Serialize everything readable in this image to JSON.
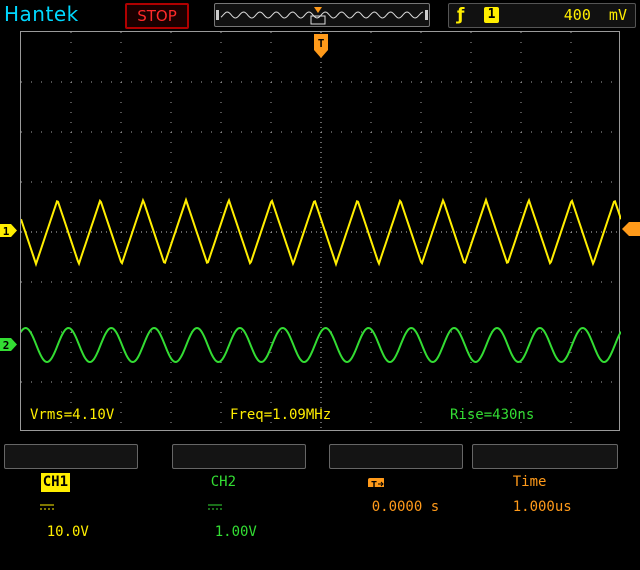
{
  "header": {
    "brand": "Hantek",
    "run_state": "STOP",
    "trigger": {
      "edge_icon": "rising-edge-icon",
      "source": "1",
      "level": "400  mV"
    }
  },
  "markers": {
    "ch1": "1",
    "ch2": "2",
    "trigger_position": "T"
  },
  "measurements": {
    "vrms": "Vrms=4.10V",
    "freq": "Freq=1.09MHz",
    "rise": "Rise=430ns"
  },
  "footer": {
    "ch1_label": "CH1",
    "ch1_scale": "10.0V",
    "ch2_label": "CH2",
    "ch2_scale": "1.00V",
    "trigger_position_value": "0.0000 s",
    "time_label": "Time",
    "time_value": "1.000us"
  },
  "colors": {
    "ch1": "#ffee00",
    "ch2": "#33dd33",
    "trigger": "#ff9a1a",
    "brand": "#00d8ff",
    "stop": "#ff2a2a"
  },
  "waveforms": {
    "ch1": {
      "shape": "triangle",
      "cycles": 14
    },
    "ch2": {
      "shape": "sine",
      "cycles": 14
    }
  }
}
